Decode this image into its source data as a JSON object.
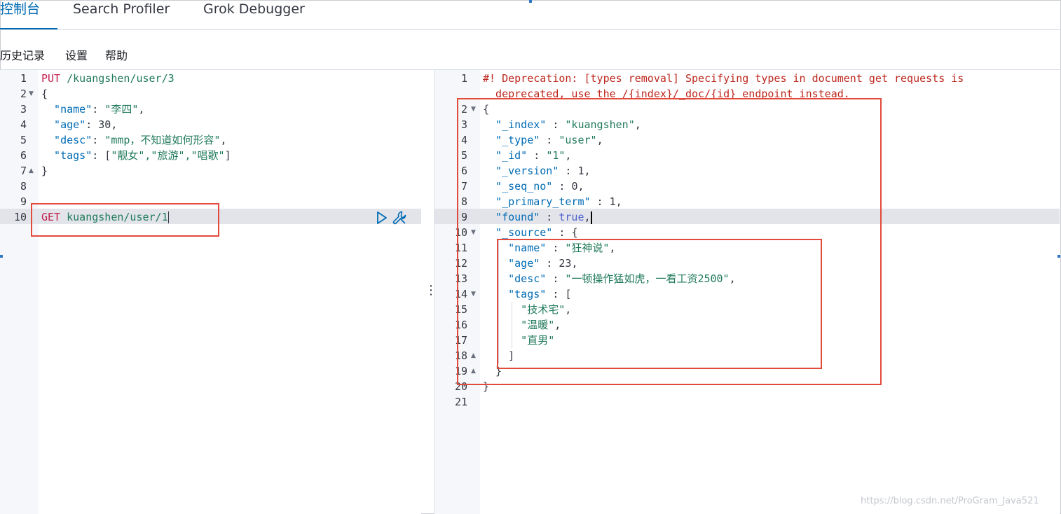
{
  "tabs": [
    {
      "label": "控制台",
      "active": true
    },
    {
      "label": "Search Profiler",
      "active": false
    },
    {
      "label": "Grok Debugger",
      "active": false
    }
  ],
  "menu": {
    "history": "历史记录",
    "settings": "设置",
    "help": "帮助"
  },
  "request_editor": {
    "line_numbers": [
      "1",
      "2",
      "3",
      "4",
      "5",
      "6",
      "7",
      "8",
      "9",
      "10"
    ],
    "lines": {
      "l1_method": "PUT",
      "l1_url": " /kuangshen/user/3",
      "l2": "{",
      "l3_key": "  \"name\"",
      "l3_sep": ": ",
      "l3_val": "\"李四\"",
      "l3_end": ",",
      "l4_key": "  \"age\"",
      "l4_sep": ": ",
      "l4_val": "30",
      "l4_end": ",",
      "l5_key": "  \"desc\"",
      "l5_sep": ": ",
      "l5_val": "\"mmp，不知道如何形容\"",
      "l5_end": ",",
      "l6_key": "  \"tags\"",
      "l6_sep": ": [",
      "l6_val": "\"靓女\",\"旅游\",\"唱歌\"",
      "l6_end": "]",
      "l7": "}",
      "l10_method": "GET",
      "l10_url": " kuangshen/user/1"
    }
  },
  "response_editor": {
    "line_numbers": [
      "1",
      "2",
      "3",
      "4",
      "5",
      "6",
      "7",
      "8",
      "9",
      "10",
      "11",
      "12",
      "13",
      "14",
      "15",
      "16",
      "17",
      "18",
      "19",
      "20",
      "21"
    ],
    "lines": {
      "warn1": "#! Deprecation: [types removal] Specifying types in document get requests is",
      "warn2": "  deprecated, use the /{index}/_doc/{id} endpoint instead.",
      "l2": "{",
      "l3_key": "  \"_index\"",
      "l3_val": "\"kuangshen\"",
      "l4_key": "  \"_type\"",
      "l4_val": "\"user\"",
      "l5_key": "  \"_id\"",
      "l5_val": "\"1\"",
      "l6_key": "  \"_version\"",
      "l6_val": "1",
      "l7_key": "  \"_seq_no\"",
      "l7_val": "0",
      "l8_key": "  \"_primary_term\"",
      "l8_val": "1",
      "l9_key": "  \"found\"",
      "l9_val": "true",
      "l10_key": "  \"_source\"",
      "l10_val": "{",
      "l11_key": "    \"name\"",
      "l11_val": "\"狂神说\"",
      "l12_key": "    \"age\"",
      "l12_val": "23",
      "l13_key": "    \"desc\"",
      "l13_val": "\"一顿操作猛如虎，一看工资2500\"",
      "l14_key": "    \"tags\"",
      "l14_val": "[",
      "l15": "      \"技术宅\"",
      "l16": "      \"温暖\"",
      "l17": "      \"直男\"",
      "l18": "    ]",
      "l19": "  }",
      "l20": "}"
    }
  },
  "watermark": "https://blog.csdn.net/ProGram_Java521",
  "colors": {
    "accent": "#006bb4",
    "annotation_box": "#e24b3b"
  }
}
